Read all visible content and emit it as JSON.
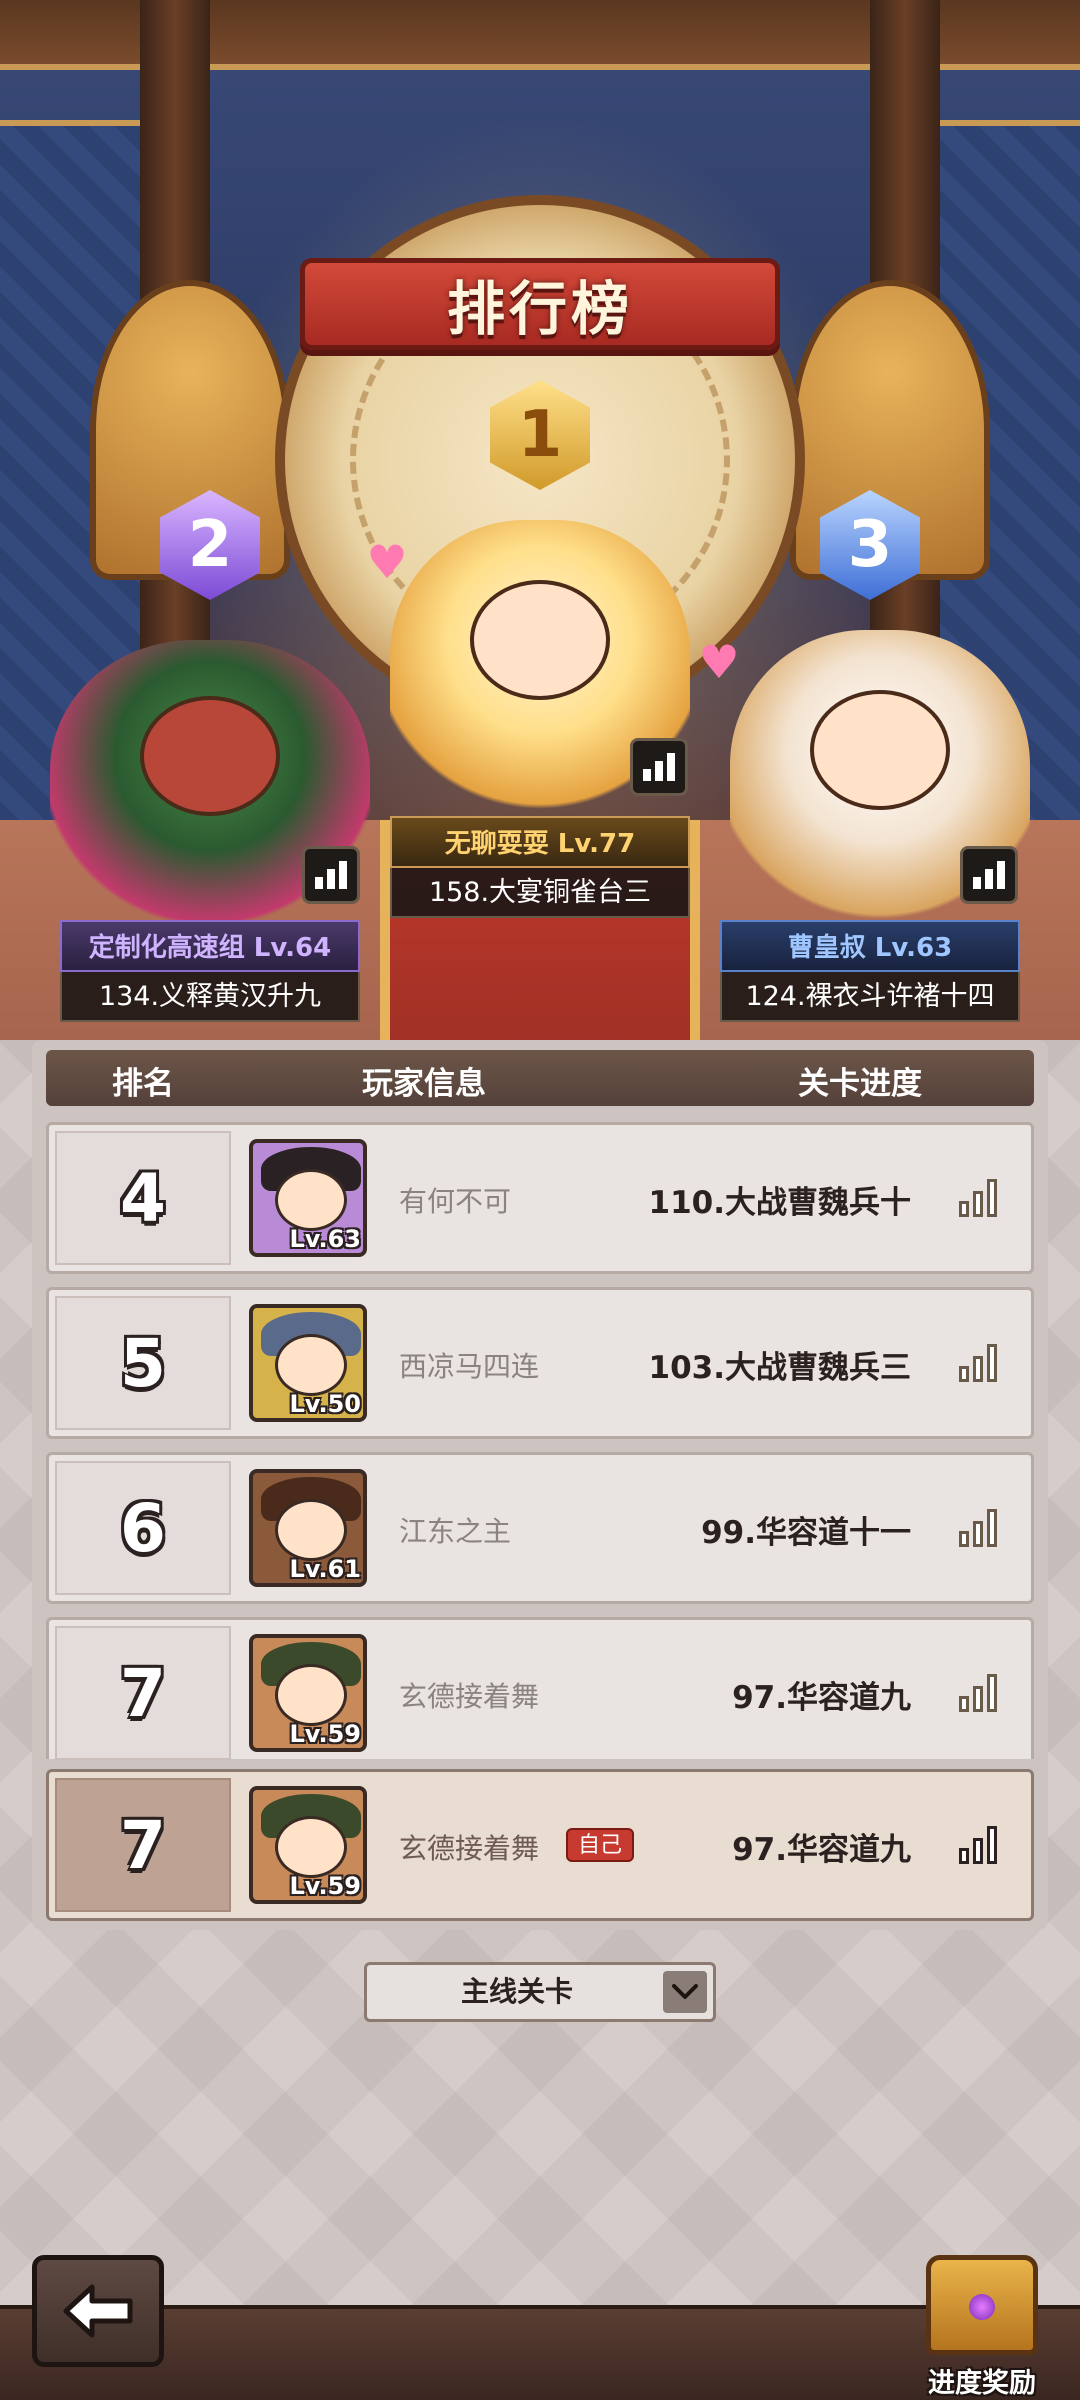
{
  "title": "排行榜",
  "podium": [
    {
      "rank": "1",
      "name": "无聊耍耍 Lv.77",
      "stage": "158.大宴铜雀台三"
    },
    {
      "rank": "2",
      "name": "定制化高速组 Lv.64",
      "stage": "134.义释黄汉升九"
    },
    {
      "rank": "3",
      "name": "曹皇叔 Lv.63",
      "stage": "124.裸衣斗许褚十四"
    }
  ],
  "list_header": {
    "rank": "排名",
    "player": "玩家信息",
    "progress": "关卡进度"
  },
  "rows": [
    {
      "rank": "4",
      "level": "Lv.63",
      "name": "有何不可",
      "progress": "110.大战曹魏兵十"
    },
    {
      "rank": "5",
      "level": "Lv.50",
      "name": "西凉马四连",
      "progress": "103.大战曹魏兵三"
    },
    {
      "rank": "6",
      "level": "Lv.61",
      "name": "江东之主",
      "progress": "99.华容道十一"
    },
    {
      "rank": "7",
      "level": "Lv.59",
      "name": "玄德接着舞",
      "progress": "97.华容道九"
    }
  ],
  "self_row": {
    "rank": "7",
    "level": "Lv.59",
    "name": "玄德接着舞",
    "tag": "自己",
    "progress": "97.华容道九"
  },
  "filter": {
    "selected": "主线关卡"
  },
  "bottom": {
    "reward_label": "进度奖励"
  },
  "icons": {
    "back": "arrow-left-icon",
    "stats": "bar-chart-icon",
    "dropdown": "chevron-down-icon",
    "reward": "treasure-chest-icon"
  },
  "colors": {
    "title_ribbon": "#c0392b",
    "rank1": "#e0a830",
    "rank2": "#8a5bdc",
    "rank3": "#4a78d6",
    "self_tag": "#c63a30"
  }
}
